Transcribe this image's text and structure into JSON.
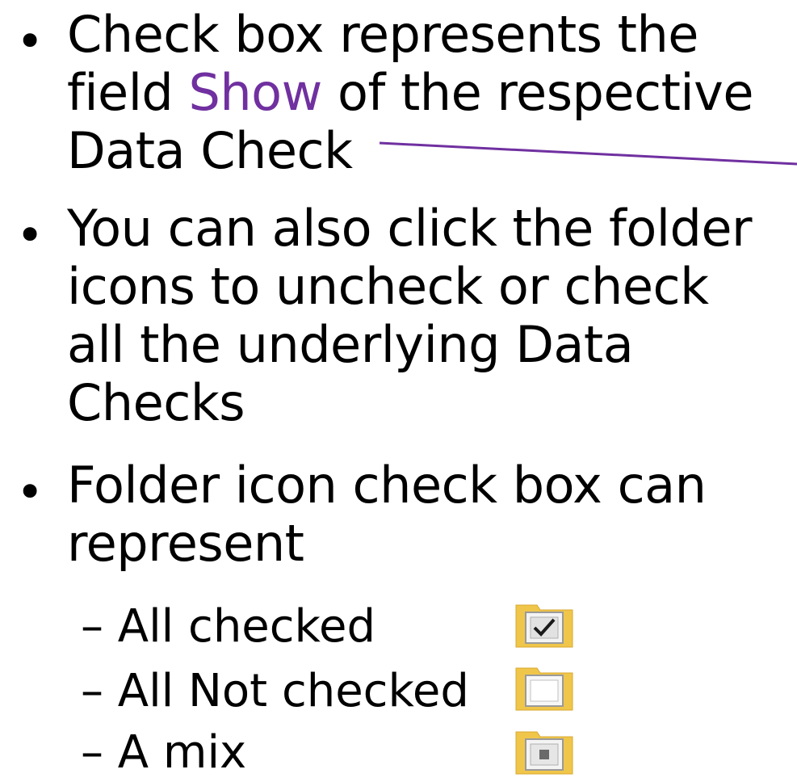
{
  "bullets": [
    {
      "lines": [
        {
          "pre": "Check box represents the",
          "highlight": "",
          "post": ""
        },
        {
          "pre": "field ",
          "highlight": "Show",
          "post": " of the respective"
        },
        {
          "pre": "Data Check",
          "highlight": "",
          "post": ""
        }
      ]
    },
    {
      "lines": [
        {
          "pre": "You can also click the folder"
        },
        {
          "pre": "icons to uncheck or check"
        },
        {
          "pre": "all the underlying Data"
        },
        {
          "pre": "Checks"
        }
      ]
    },
    {
      "lines": [
        {
          "pre": "Folder icon check box can"
        },
        {
          "pre": "represent"
        }
      ]
    }
  ],
  "sub_items": [
    {
      "label": "– All checked",
      "state": "checked"
    },
    {
      "label": "– All Not checked",
      "state": "unchecked"
    },
    {
      "label": "– A mix",
      "state": "mixed"
    }
  ],
  "colors": {
    "highlight": "#7030A0",
    "connector": "#7030A0",
    "folder": "#F0C64A"
  },
  "bullet_glyph": "•"
}
